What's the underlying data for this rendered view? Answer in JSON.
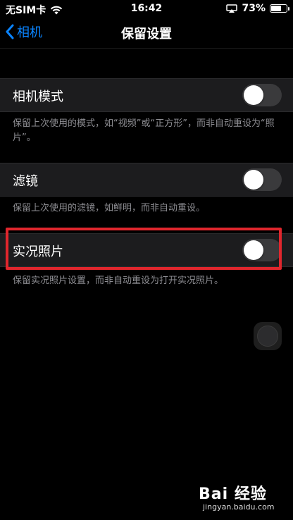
{
  "status_bar": {
    "carrier": "无SIM卡",
    "time": "16:42",
    "battery_percent_label": "73%",
    "battery_level": 0.73
  },
  "nav": {
    "back_label": "相机",
    "title": "保留设置"
  },
  "settings": [
    {
      "label": "相机模式",
      "enabled": false,
      "description": "保留上次使用的模式，如“视频”或“正方形”，而非自动重设为“照片”。"
    },
    {
      "label": "滤镜",
      "enabled": false,
      "description": "保留上次使用的滤镜，如鲜明，而非自动重设。"
    },
    {
      "label": "实况照片",
      "enabled": false,
      "description": "保留实况照片设置，而非自动重设为打开实况照片。"
    }
  ],
  "watermark": {
    "main": "Bai 经验",
    "sub": "jingyan.baidu.com"
  },
  "colors": {
    "accent": "#0a84ff",
    "highlight": "#e0262d",
    "toggle_off": "#3a3a3c"
  }
}
